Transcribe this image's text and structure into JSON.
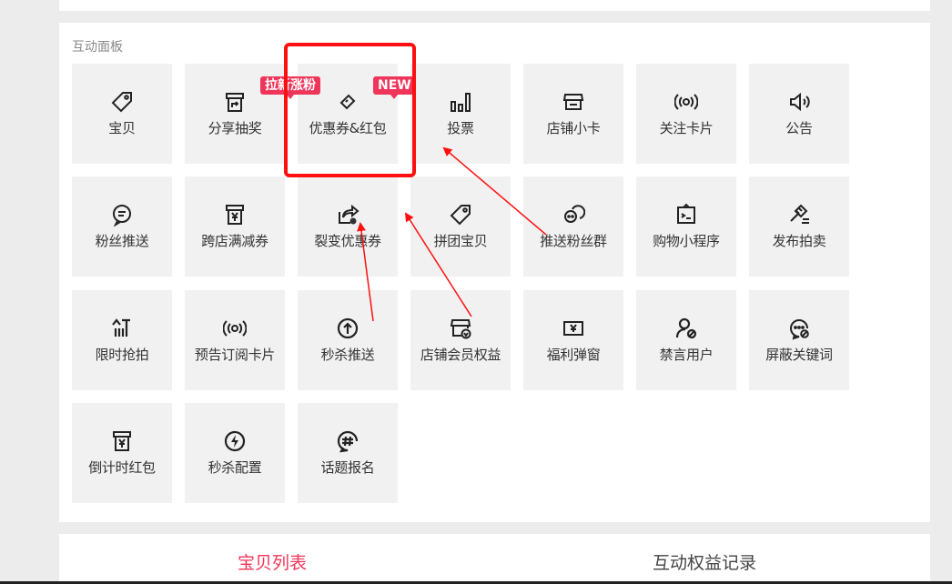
{
  "panel": {
    "title": "互动面板",
    "tiles": [
      {
        "label": "宝贝",
        "icon": "tag-icon"
      },
      {
        "label": "分享抽奖",
        "icon": "share-box-icon"
      },
      {
        "label": "优惠券&红包",
        "icon": "coupon-icon"
      },
      {
        "label": "投票",
        "icon": "vote-bars-icon"
      },
      {
        "label": "店铺小卡",
        "icon": "store-icon"
      },
      {
        "label": "关注卡片",
        "icon": "broadcast-icon"
      },
      {
        "label": "公告",
        "icon": "speaker-icon"
      },
      {
        "label": "粉丝推送",
        "icon": "chat-bubble-icon"
      },
      {
        "label": "跨店满减券",
        "icon": "yen-box-icon"
      },
      {
        "label": "裂变优惠券",
        "icon": "share-coupon-icon"
      },
      {
        "label": "拼团宝贝",
        "icon": "tag-icon"
      },
      {
        "label": "推送粉丝群",
        "icon": "group-chat-icon"
      },
      {
        "label": "购物小程序",
        "icon": "mini-program-icon"
      },
      {
        "label": "发布拍卖",
        "icon": "gavel-icon"
      },
      {
        "label": "限时抢拍",
        "icon": "flash-sale-icon"
      },
      {
        "label": "预告订阅卡片",
        "icon": "broadcast-icon"
      },
      {
        "label": "秒杀推送",
        "icon": "arrow-up-circle-icon"
      },
      {
        "label": "店铺会员权益",
        "icon": "member-store-icon"
      },
      {
        "label": "福利弹窗",
        "icon": "yen-window-icon"
      },
      {
        "label": "禁言用户",
        "icon": "mute-user-icon"
      },
      {
        "label": "屏蔽关键词",
        "icon": "block-keyword-icon"
      },
      {
        "label": "倒计时红包",
        "icon": "yen-box-icon"
      },
      {
        "label": "秒杀配置",
        "icon": "lightning-circle-icon"
      },
      {
        "label": "话题报名",
        "icon": "hashtag-icon"
      }
    ],
    "badges": {
      "lachang": "拉新涨粉",
      "new": "NEW"
    }
  },
  "tabs": {
    "active": "宝贝列表",
    "inactive": "互动权益记录"
  },
  "colors": {
    "accent": "#f0355a",
    "annotation": "#ff1010"
  }
}
